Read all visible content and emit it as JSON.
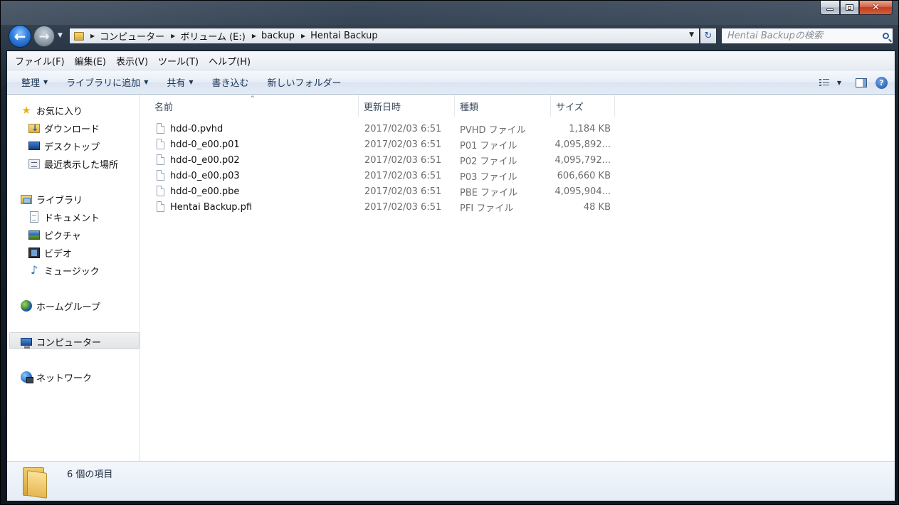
{
  "window": {
    "caption_buttons": {
      "minimize_icon": "minimize-icon",
      "maximize_icon": "maximize-icon",
      "close_icon": "close-icon",
      "close_glyph": "✕"
    }
  },
  "nav": {
    "back_glyph": "←",
    "forward_glyph": "→",
    "recent_glyph": "▼"
  },
  "address": {
    "crumbs": [
      "コンピューター",
      "ボリューム (E:)",
      "backup",
      "Hentai Backup"
    ],
    "separator": "▶",
    "dropdown_glyph": "▼",
    "refresh_glyph": "↻"
  },
  "search": {
    "placeholder": "Hentai Backupの検索"
  },
  "menubar": {
    "items": [
      "ファイル(F)",
      "編集(E)",
      "表示(V)",
      "ツール(T)",
      "ヘルプ(H)"
    ]
  },
  "toolbar": {
    "organize": "整理",
    "include_library": "ライブラリに追加",
    "share": "共有",
    "burn": "書き込む",
    "new_folder": "新しいフォルダー",
    "dropdown_glyph": "▼",
    "help_glyph": "?"
  },
  "sidebar": {
    "favorites": {
      "label": "お気に入り",
      "icon": "star-icon"
    },
    "favorites_items": [
      {
        "label": "ダウンロード",
        "icon": "downloads-folder-icon"
      },
      {
        "label": "デスクトップ",
        "icon": "desktop-icon"
      },
      {
        "label": "最近表示した場所",
        "icon": "recent-places-icon"
      }
    ],
    "libraries": {
      "label": "ライブラリ",
      "icon": "library-icon"
    },
    "libraries_items": [
      {
        "label": "ドキュメント",
        "icon": "documents-icon"
      },
      {
        "label": "ピクチャ",
        "icon": "pictures-icon"
      },
      {
        "label": "ビデオ",
        "icon": "videos-icon"
      },
      {
        "label": "ミュージック",
        "icon": "music-icon"
      }
    ],
    "homegroup": {
      "label": "ホームグループ",
      "icon": "homegroup-icon"
    },
    "computer": {
      "label": "コンピューター",
      "icon": "computer-icon",
      "selected": true
    },
    "network": {
      "label": "ネットワーク",
      "icon": "network-icon"
    },
    "star_glyph": "★",
    "music_glyph": "♪"
  },
  "columns": {
    "name": "名前",
    "date": "更新日時",
    "type": "種類",
    "size": "サイズ",
    "sort_glyph": "^"
  },
  "files": [
    {
      "name": "hdd-0.pvhd",
      "date": "2017/02/03 6:51",
      "type": "PVHD ファイル",
      "size": "1,184 KB"
    },
    {
      "name": "hdd-0_e00.p01",
      "date": "2017/02/03 6:51",
      "type": "P01 ファイル",
      "size": "4,095,892..."
    },
    {
      "name": "hdd-0_e00.p02",
      "date": "2017/02/03 6:51",
      "type": "P02 ファイル",
      "size": "4,095,792..."
    },
    {
      "name": "hdd-0_e00.p03",
      "date": "2017/02/03 6:51",
      "type": "P03 ファイル",
      "size": "606,660 KB"
    },
    {
      "name": "hdd-0_e00.pbe",
      "date": "2017/02/03 6:51",
      "type": "PBE ファイル",
      "size": "4,095,904..."
    },
    {
      "name": "Hentai Backup.pfi",
      "date": "2017/02/03 6:51",
      "type": "PFI ファイル",
      "size": "48 KB"
    }
  ],
  "details": {
    "item_count": "6 個の項目"
  }
}
